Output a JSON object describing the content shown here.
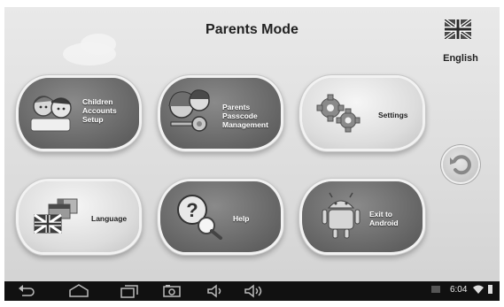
{
  "header": {
    "title": "Parents Mode"
  },
  "language": {
    "label": "English",
    "flag_icon": "uk-flag-icon"
  },
  "tiles": [
    {
      "id": "children-accounts-setup",
      "label": "Children\nAccounts\nSetup",
      "icon": "children-icon",
      "style": "dark"
    },
    {
      "id": "parents-passcode-management",
      "label": "Parents\nPasscode\nManagement",
      "icon": "parents-key-icon",
      "style": "dark"
    },
    {
      "id": "settings",
      "label": "Settings",
      "icon": "gears-icon",
      "style": "light"
    },
    {
      "id": "language",
      "label": "Language",
      "icon": "flags-icon",
      "style": "light"
    },
    {
      "id": "help",
      "label": "Help",
      "icon": "help-magnifier-icon",
      "style": "dark"
    },
    {
      "id": "exit-to-android",
      "label": "Exit to\nAndroid",
      "icon": "android-icon",
      "style": "dark"
    }
  ],
  "back_button": {
    "icon": "undo-arrow-icon"
  },
  "navbar": {
    "icons": [
      "back-icon",
      "home-icon",
      "recent-apps-icon",
      "screenshot-icon",
      "volume-down-icon",
      "volume-up-icon"
    ],
    "status": {
      "time": "6:04",
      "icons": [
        "notification-icon",
        "wifi-icon",
        "battery-icon"
      ]
    }
  },
  "colors": {
    "navbar": "#111111",
    "dark_tile": "#6a6a6a",
    "light_tile": "#dcdcdc"
  }
}
